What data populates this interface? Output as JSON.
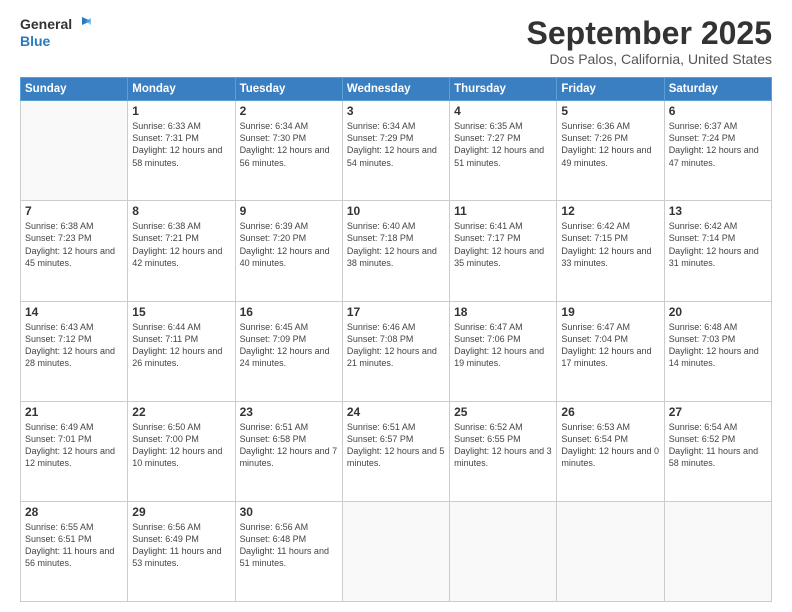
{
  "logo": {
    "line1": "General",
    "line2": "Blue"
  },
  "title": "September 2025",
  "subtitle": "Dos Palos, California, United States",
  "headers": [
    "Sunday",
    "Monday",
    "Tuesday",
    "Wednesday",
    "Thursday",
    "Friday",
    "Saturday"
  ],
  "weeks": [
    [
      {
        "day": "",
        "empty": true
      },
      {
        "day": "1",
        "sunrise": "Sunrise: 6:33 AM",
        "sunset": "Sunset: 7:31 PM",
        "daylight": "Daylight: 12 hours and 58 minutes."
      },
      {
        "day": "2",
        "sunrise": "Sunrise: 6:34 AM",
        "sunset": "Sunset: 7:30 PM",
        "daylight": "Daylight: 12 hours and 56 minutes."
      },
      {
        "day": "3",
        "sunrise": "Sunrise: 6:34 AM",
        "sunset": "Sunset: 7:29 PM",
        "daylight": "Daylight: 12 hours and 54 minutes."
      },
      {
        "day": "4",
        "sunrise": "Sunrise: 6:35 AM",
        "sunset": "Sunset: 7:27 PM",
        "daylight": "Daylight: 12 hours and 51 minutes."
      },
      {
        "day": "5",
        "sunrise": "Sunrise: 6:36 AM",
        "sunset": "Sunset: 7:26 PM",
        "daylight": "Daylight: 12 hours and 49 minutes."
      },
      {
        "day": "6",
        "sunrise": "Sunrise: 6:37 AM",
        "sunset": "Sunset: 7:24 PM",
        "daylight": "Daylight: 12 hours and 47 minutes."
      }
    ],
    [
      {
        "day": "7",
        "sunrise": "Sunrise: 6:38 AM",
        "sunset": "Sunset: 7:23 PM",
        "daylight": "Daylight: 12 hours and 45 minutes."
      },
      {
        "day": "8",
        "sunrise": "Sunrise: 6:38 AM",
        "sunset": "Sunset: 7:21 PM",
        "daylight": "Daylight: 12 hours and 42 minutes."
      },
      {
        "day": "9",
        "sunrise": "Sunrise: 6:39 AM",
        "sunset": "Sunset: 7:20 PM",
        "daylight": "Daylight: 12 hours and 40 minutes."
      },
      {
        "day": "10",
        "sunrise": "Sunrise: 6:40 AM",
        "sunset": "Sunset: 7:18 PM",
        "daylight": "Daylight: 12 hours and 38 minutes."
      },
      {
        "day": "11",
        "sunrise": "Sunrise: 6:41 AM",
        "sunset": "Sunset: 7:17 PM",
        "daylight": "Daylight: 12 hours and 35 minutes."
      },
      {
        "day": "12",
        "sunrise": "Sunrise: 6:42 AM",
        "sunset": "Sunset: 7:15 PM",
        "daylight": "Daylight: 12 hours and 33 minutes."
      },
      {
        "day": "13",
        "sunrise": "Sunrise: 6:42 AM",
        "sunset": "Sunset: 7:14 PM",
        "daylight": "Daylight: 12 hours and 31 minutes."
      }
    ],
    [
      {
        "day": "14",
        "sunrise": "Sunrise: 6:43 AM",
        "sunset": "Sunset: 7:12 PM",
        "daylight": "Daylight: 12 hours and 28 minutes."
      },
      {
        "day": "15",
        "sunrise": "Sunrise: 6:44 AM",
        "sunset": "Sunset: 7:11 PM",
        "daylight": "Daylight: 12 hours and 26 minutes."
      },
      {
        "day": "16",
        "sunrise": "Sunrise: 6:45 AM",
        "sunset": "Sunset: 7:09 PM",
        "daylight": "Daylight: 12 hours and 24 minutes."
      },
      {
        "day": "17",
        "sunrise": "Sunrise: 6:46 AM",
        "sunset": "Sunset: 7:08 PM",
        "daylight": "Daylight: 12 hours and 21 minutes."
      },
      {
        "day": "18",
        "sunrise": "Sunrise: 6:47 AM",
        "sunset": "Sunset: 7:06 PM",
        "daylight": "Daylight: 12 hours and 19 minutes."
      },
      {
        "day": "19",
        "sunrise": "Sunrise: 6:47 AM",
        "sunset": "Sunset: 7:04 PM",
        "daylight": "Daylight: 12 hours and 17 minutes."
      },
      {
        "day": "20",
        "sunrise": "Sunrise: 6:48 AM",
        "sunset": "Sunset: 7:03 PM",
        "daylight": "Daylight: 12 hours and 14 minutes."
      }
    ],
    [
      {
        "day": "21",
        "sunrise": "Sunrise: 6:49 AM",
        "sunset": "Sunset: 7:01 PM",
        "daylight": "Daylight: 12 hours and 12 minutes."
      },
      {
        "day": "22",
        "sunrise": "Sunrise: 6:50 AM",
        "sunset": "Sunset: 7:00 PM",
        "daylight": "Daylight: 12 hours and 10 minutes."
      },
      {
        "day": "23",
        "sunrise": "Sunrise: 6:51 AM",
        "sunset": "Sunset: 6:58 PM",
        "daylight": "Daylight: 12 hours and 7 minutes."
      },
      {
        "day": "24",
        "sunrise": "Sunrise: 6:51 AM",
        "sunset": "Sunset: 6:57 PM",
        "daylight": "Daylight: 12 hours and 5 minutes."
      },
      {
        "day": "25",
        "sunrise": "Sunrise: 6:52 AM",
        "sunset": "Sunset: 6:55 PM",
        "daylight": "Daylight: 12 hours and 3 minutes."
      },
      {
        "day": "26",
        "sunrise": "Sunrise: 6:53 AM",
        "sunset": "Sunset: 6:54 PM",
        "daylight": "Daylight: 12 hours and 0 minutes."
      },
      {
        "day": "27",
        "sunrise": "Sunrise: 6:54 AM",
        "sunset": "Sunset: 6:52 PM",
        "daylight": "Daylight: 11 hours and 58 minutes."
      }
    ],
    [
      {
        "day": "28",
        "sunrise": "Sunrise: 6:55 AM",
        "sunset": "Sunset: 6:51 PM",
        "daylight": "Daylight: 11 hours and 56 minutes."
      },
      {
        "day": "29",
        "sunrise": "Sunrise: 6:56 AM",
        "sunset": "Sunset: 6:49 PM",
        "daylight": "Daylight: 11 hours and 53 minutes."
      },
      {
        "day": "30",
        "sunrise": "Sunrise: 6:56 AM",
        "sunset": "Sunset: 6:48 PM",
        "daylight": "Daylight: 11 hours and 51 minutes."
      },
      {
        "day": "",
        "empty": true
      },
      {
        "day": "",
        "empty": true
      },
      {
        "day": "",
        "empty": true
      },
      {
        "day": "",
        "empty": true
      }
    ]
  ]
}
